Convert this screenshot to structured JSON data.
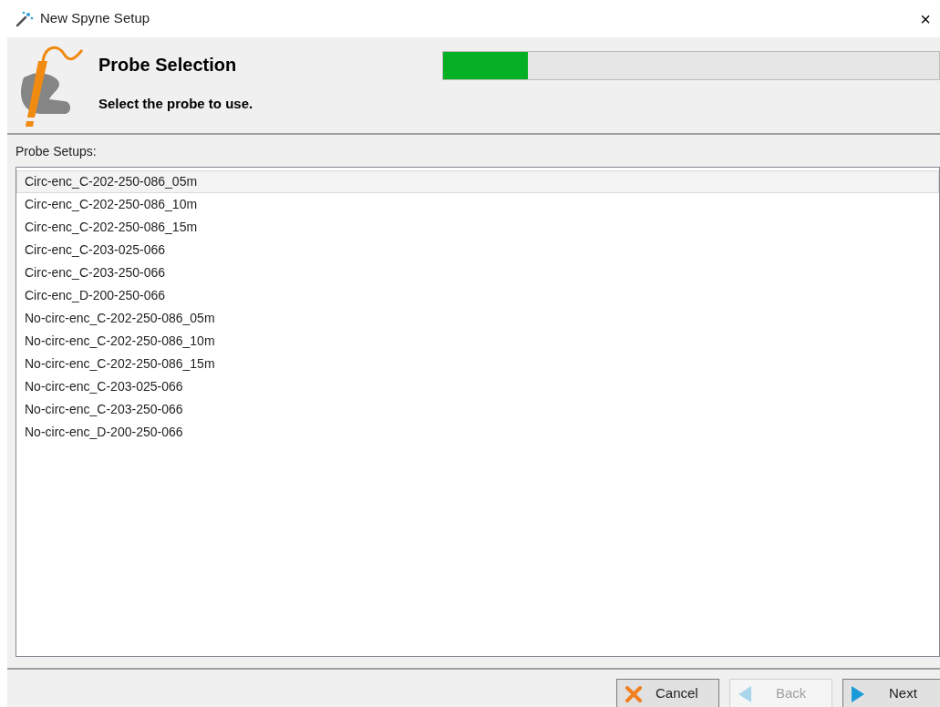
{
  "window": {
    "title": "New Spyne Setup",
    "close": "×"
  },
  "header": {
    "title": "Probe Selection",
    "subtitle": "Select the probe to use.",
    "progress": {
      "level": 0.17
    }
  },
  "probe_setups": {
    "label": "Probe Setups:",
    "items": [
      {
        "label": "Circ-enc_C-202-250-086_05m",
        "selected": true
      },
      {
        "label": "Circ-enc_C-202-250-086_10m",
        "selected": false
      },
      {
        "label": "Circ-enc_C-202-250-086_15m",
        "selected": false
      },
      {
        "label": "Circ-enc_C-203-025-066",
        "selected": false
      },
      {
        "label": "Circ-enc_C-203-250-066",
        "selected": false
      },
      {
        "label": "Circ-enc_D-200-250-066",
        "selected": false
      },
      {
        "label": "No-circ-enc_C-202-250-086_05m",
        "selected": false
      },
      {
        "label": "No-circ-enc_C-202-250-086_10m",
        "selected": false
      },
      {
        "label": "No-circ-enc_C-202-250-086_15m",
        "selected": false
      },
      {
        "label": "No-circ-enc_C-203-025-066",
        "selected": false
      },
      {
        "label": "No-circ-enc_C-203-250-066",
        "selected": false
      },
      {
        "label": "No-circ-enc_D-200-250-066",
        "selected": false
      }
    ]
  },
  "buttons": [
    {
      "kind": "cancel",
      "label": "Cancel",
      "disabled": false
    },
    {
      "kind": "back",
      "label": "Back",
      "disabled": true
    },
    {
      "kind": "next",
      "label": "Next",
      "disabled": false
    }
  ]
}
